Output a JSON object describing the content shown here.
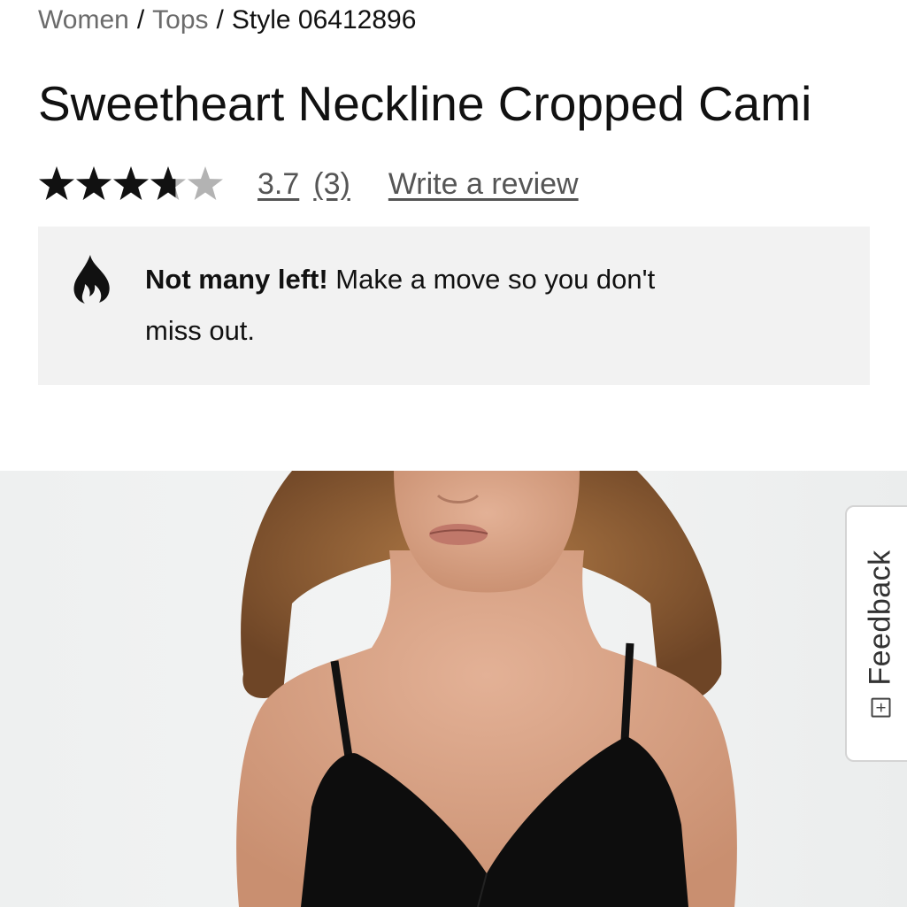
{
  "breadcrumb": {
    "items": [
      "Women",
      "Tops"
    ],
    "separator": "/",
    "current": "Style 06412896"
  },
  "product": {
    "title": "Sweetheart Neckline Cropped Cami",
    "rating": 3.7,
    "rating_text": "3.7",
    "review_count_text": "(3)",
    "stars_max": 5,
    "write_review_label": "Write a review"
  },
  "notice": {
    "icon": "flame-icon",
    "bold_text": "Not many left!",
    "text": " Make a move so you don't miss out."
  },
  "feedback": {
    "icon": "plus-box-icon",
    "label": "Feedback"
  },
  "colors": {
    "star_filled": "#111111",
    "star_empty": "#b3b3b3",
    "notice_bg": "#f2f2f2",
    "link": "#555555"
  }
}
